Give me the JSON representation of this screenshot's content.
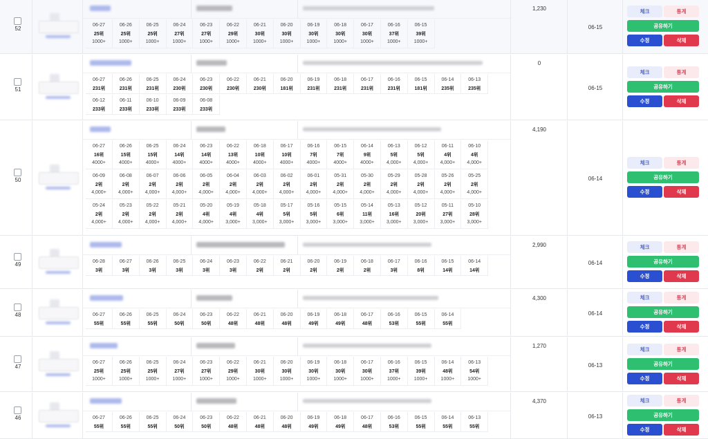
{
  "buttons": {
    "check": "체크",
    "stats": "통계",
    "share": "공유하기",
    "edit": "수정",
    "delete": "삭제"
  },
  "rows": [
    {
      "id": "52",
      "count": "1,230",
      "date": "06-15",
      "cells": [
        [
          "06-27",
          "25위",
          "1000+"
        ],
        [
          "06-26",
          "25위",
          "1000+"
        ],
        [
          "06-25",
          "25위",
          "1000+"
        ],
        [
          "06-24",
          "27위",
          "1000+"
        ],
        [
          "06-23",
          "27위",
          "1000+"
        ],
        [
          "06-22",
          "29위",
          "1000+"
        ],
        [
          "06-21",
          "30위",
          "1000+"
        ],
        [
          "06-20",
          "30위",
          "1000+"
        ],
        [
          "06-19",
          "30위",
          "1000+"
        ],
        [
          "06-18",
          "30위",
          "1000+"
        ],
        [
          "06-17",
          "30위",
          "1000+"
        ],
        [
          "06-16",
          "37위",
          "1000+"
        ],
        [
          "06-15",
          "39위",
          "1000+"
        ]
      ]
    },
    {
      "id": "51",
      "count": "0",
      "date": "06-15",
      "cells": [
        [
          "06-27",
          "231위"
        ],
        [
          "06-26",
          "231위"
        ],
        [
          "06-25",
          "231위"
        ],
        [
          "06-24",
          "230위"
        ],
        [
          "06-23",
          "230위"
        ],
        [
          "06-22",
          "230위"
        ],
        [
          "06-21",
          "230위"
        ],
        [
          "06-20",
          "181위"
        ],
        [
          "06-19",
          "231위"
        ],
        [
          "06-18",
          "231위"
        ],
        [
          "06-17",
          "231위"
        ],
        [
          "06-16",
          "231위"
        ],
        [
          "06-15",
          "181위"
        ],
        [
          "06-14",
          "235위"
        ],
        [
          "06-13",
          "235위"
        ],
        [
          "06-12",
          "233위"
        ],
        [
          "06-11",
          "233위"
        ],
        [
          "06-10",
          "233위"
        ],
        [
          "06-09",
          "233위"
        ],
        [
          "06-08",
          "233위"
        ]
      ]
    },
    {
      "id": "50",
      "count": "4,190",
      "date": "06-14",
      "cells": [
        [
          "06-27",
          "16위",
          "4000+"
        ],
        [
          "06-26",
          "15위",
          "4000+"
        ],
        [
          "06-25",
          "15위",
          "4000+"
        ],
        [
          "06-24",
          "14위",
          "4000+"
        ],
        [
          "06-23",
          "14위",
          "4000+"
        ],
        [
          "06-22",
          "13위",
          "4000+"
        ],
        [
          "06-18",
          "10위",
          "4000+"
        ],
        [
          "06-17",
          "10위",
          "4000+"
        ],
        [
          "06-16",
          "7위",
          "4000+"
        ],
        [
          "06-15",
          "7위",
          "4000+"
        ],
        [
          "06-14",
          "9위",
          "4000+"
        ],
        [
          "06-13",
          "5위",
          "4,000+"
        ],
        [
          "06-12",
          "5위",
          "4,000+"
        ],
        [
          "06-11",
          "4위",
          "4,000+"
        ],
        [
          "06-10",
          "4위",
          "4,000+"
        ],
        [
          "06-09",
          "2위",
          "4,000+"
        ],
        [
          "06-08",
          "2위",
          "4,000+"
        ],
        [
          "06-07",
          "2위",
          "4,000+"
        ],
        [
          "06-06",
          "2위",
          "4,000+"
        ],
        [
          "06-05",
          "2위",
          "4,000+"
        ],
        [
          "06-04",
          "2위",
          "4,000+"
        ],
        [
          "06-03",
          "2위",
          "4,000+"
        ],
        [
          "06-02",
          "2위",
          "4,000+"
        ],
        [
          "06-01",
          "2위",
          "4,000+"
        ],
        [
          "05-31",
          "2위",
          "4,000+"
        ],
        [
          "05-30",
          "2위",
          "4,000+"
        ],
        [
          "05-29",
          "2위",
          "4,000+"
        ],
        [
          "05-28",
          "2위",
          "4,000+"
        ],
        [
          "05-26",
          "2위",
          "4,000+"
        ],
        [
          "05-25",
          "2위",
          "4,000+"
        ],
        [
          "05-24",
          "2위",
          "4,000+"
        ],
        [
          "05-23",
          "2위",
          "4,000+"
        ],
        [
          "05-22",
          "2위",
          "4,000+"
        ],
        [
          "05-21",
          "2위",
          "4,000+"
        ],
        [
          "05-20",
          "4위",
          "4,000+"
        ],
        [
          "05-19",
          "4위",
          "3,000+"
        ],
        [
          "05-18",
          "4위",
          "3,000+"
        ],
        [
          "05-17",
          "5위",
          "3,000+"
        ],
        [
          "05-16",
          "5위",
          "3,000+"
        ],
        [
          "05-15",
          "6위",
          "3,000+"
        ],
        [
          "05-14",
          "11위",
          "3,000+"
        ],
        [
          "05-13",
          "16위",
          "3,000+"
        ],
        [
          "05-12",
          "20위",
          "3,000+"
        ],
        [
          "05-11",
          "27위",
          "3,000+"
        ],
        [
          "05-10",
          "28위",
          "3,000+"
        ]
      ]
    },
    {
      "id": "49",
      "count": "2,990",
      "date": "06-14",
      "cells": [
        [
          "06-28",
          "3위"
        ],
        [
          "06-27",
          "3위"
        ],
        [
          "06-26",
          "3위"
        ],
        [
          "06-25",
          "3위"
        ],
        [
          "06-24",
          "3위"
        ],
        [
          "06-23",
          "3위"
        ],
        [
          "06-22",
          "2위"
        ],
        [
          "06-21",
          "2위"
        ],
        [
          "06-20",
          "2위"
        ],
        [
          "06-19",
          "2위"
        ],
        [
          "06-18",
          "2위"
        ],
        [
          "06-17",
          "3위"
        ],
        [
          "06-16",
          "8위"
        ],
        [
          "06-15",
          "14위"
        ],
        [
          "06-14",
          "14위"
        ]
      ]
    },
    {
      "id": "48",
      "count": "4,300",
      "date": "06-14",
      "cells": [
        [
          "06-27",
          "55위"
        ],
        [
          "06-26",
          "55위"
        ],
        [
          "06-25",
          "55위"
        ],
        [
          "06-24",
          "50위"
        ],
        [
          "06-23",
          "50위"
        ],
        [
          "06-22",
          "48위"
        ],
        [
          "06-21",
          "48위"
        ],
        [
          "06-20",
          "48위"
        ],
        [
          "06-19",
          "49위"
        ],
        [
          "06-18",
          "49위"
        ],
        [
          "06-17",
          "48위"
        ],
        [
          "06-16",
          "53위"
        ],
        [
          "06-15",
          "55위"
        ],
        [
          "06-14",
          "55위"
        ]
      ]
    },
    {
      "id": "47",
      "count": "1,270",
      "date": "06-13",
      "cells": [
        [
          "06-27",
          "25위",
          "1000+"
        ],
        [
          "06-26",
          "25위",
          "1000+"
        ],
        [
          "06-25",
          "25위",
          "1000+"
        ],
        [
          "06-24",
          "27위",
          "1000+"
        ],
        [
          "06-23",
          "27위",
          "1000+"
        ],
        [
          "06-22",
          "29위",
          "1000+"
        ],
        [
          "06-21",
          "30위",
          "1000+"
        ],
        [
          "06-20",
          "30위",
          "1000+"
        ],
        [
          "06-19",
          "30위",
          "1000+"
        ],
        [
          "06-18",
          "30위",
          "1000+"
        ],
        [
          "06-17",
          "30위",
          "1000+"
        ],
        [
          "06-16",
          "37위",
          "1000+"
        ],
        [
          "06-15",
          "39위",
          "1000+"
        ],
        [
          "06-14",
          "48위",
          "1000+"
        ],
        [
          "06-13",
          "54위",
          "1000+"
        ]
      ]
    },
    {
      "id": "46",
      "count": "4,370",
      "date": "06-13",
      "cells": [
        [
          "06-27",
          "55위"
        ],
        [
          "06-26",
          "55위"
        ],
        [
          "06-25",
          "55위"
        ],
        [
          "06-24",
          "50위"
        ],
        [
          "06-23",
          "50위"
        ],
        [
          "06-22",
          "48위"
        ],
        [
          "06-21",
          "48위"
        ],
        [
          "06-20",
          "48위"
        ],
        [
          "06-19",
          "49위"
        ],
        [
          "06-18",
          "49위"
        ],
        [
          "06-17",
          "48위"
        ],
        [
          "06-16",
          "53위"
        ],
        [
          "06-15",
          "55위"
        ],
        [
          "06-14",
          "55위"
        ],
        [
          "06-13",
          "55위"
        ]
      ]
    }
  ]
}
